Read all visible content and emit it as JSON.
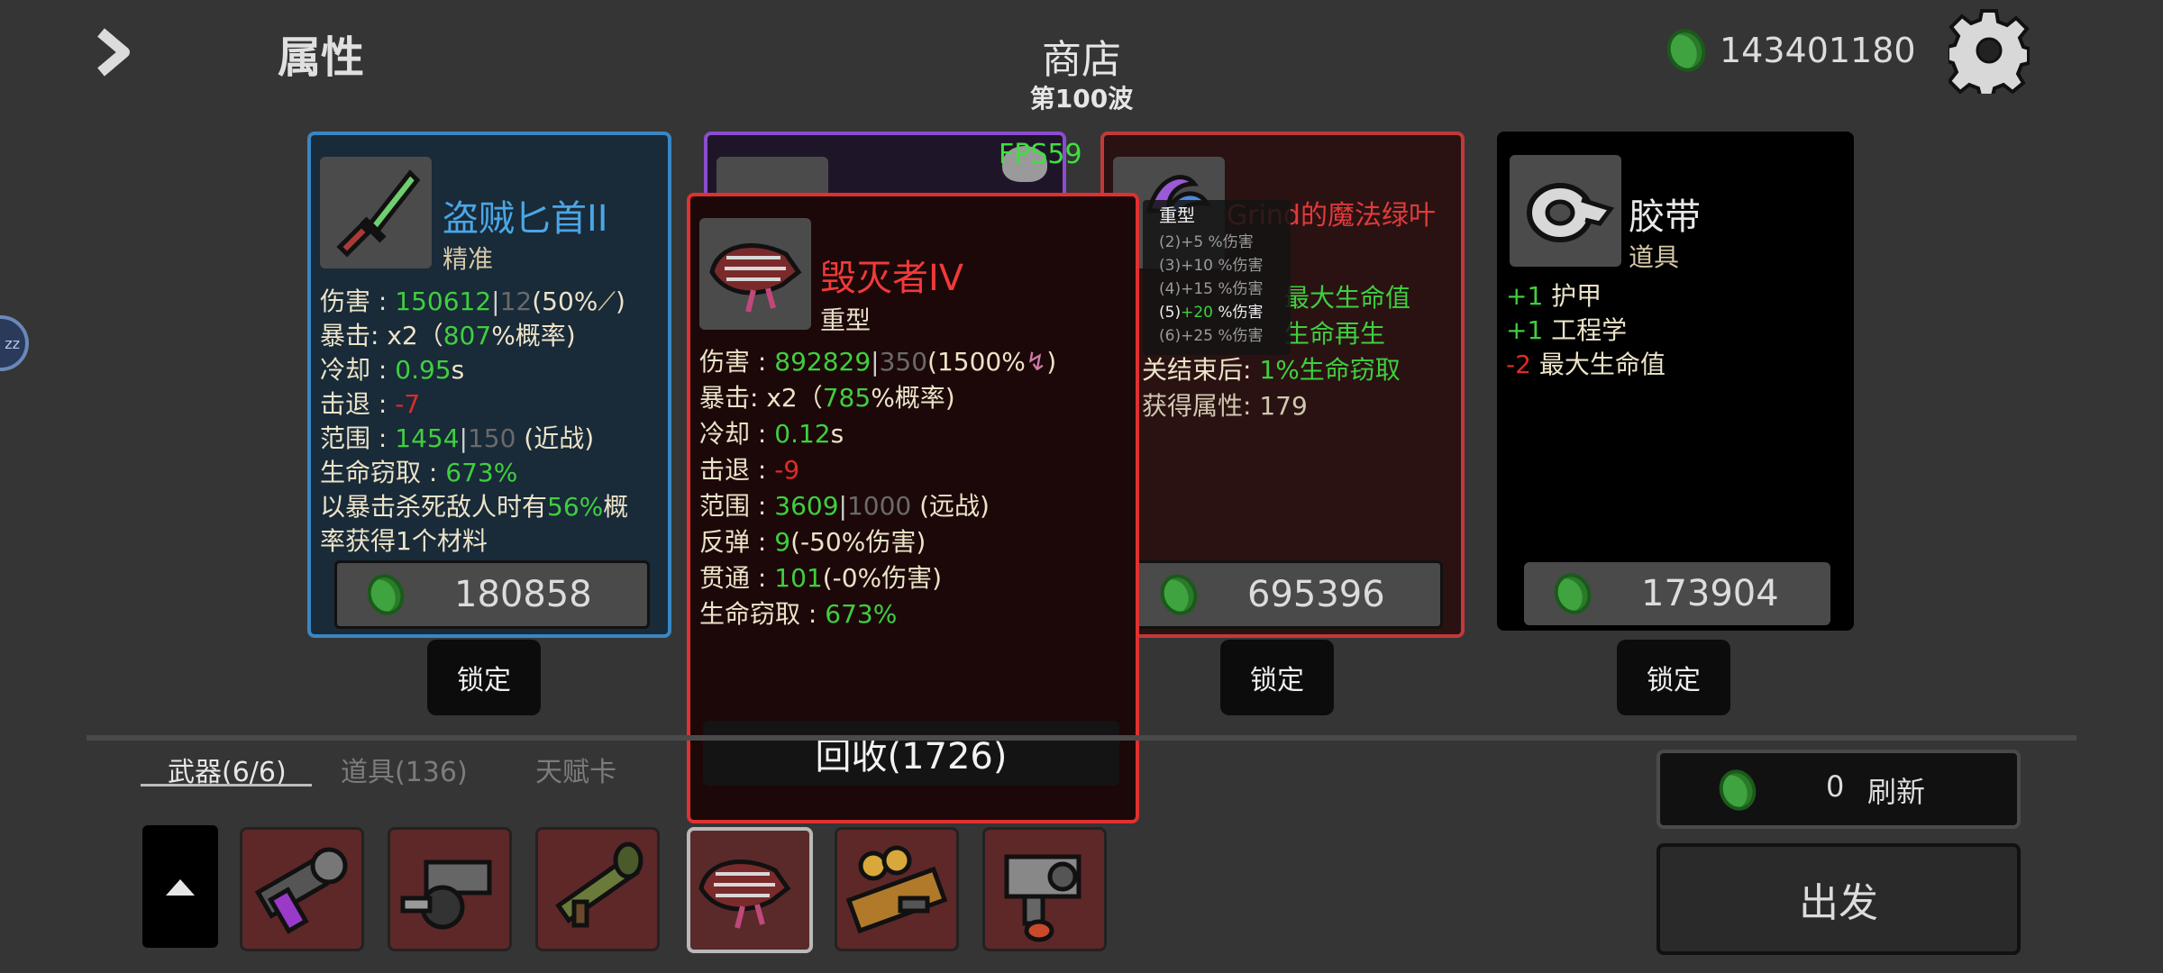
{
  "header": {
    "stats_label": "属性",
    "shop_title": "商店",
    "wave": "第100波",
    "money": "143401180"
  },
  "fps": "FPS59",
  "side_badge": "zz",
  "cards": [
    {
      "name": "盗贼匕首II",
      "type": "精准",
      "stats": {
        "dmg_label": "伤害 : ",
        "dmg_val": "150612",
        "dmg_base": "12",
        "dmg_scale": "(50%",
        "dmg_end": ")",
        "crit_label": "暴击:  x2（",
        "crit_val": "807",
        "crit_end": "%概率)",
        "cd_label": "冷却 : ",
        "cd_val": "0.95",
        "cd_unit": "s",
        "kb_label": "击退 : ",
        "kb_val": "-7",
        "range_label": "范围 : ",
        "range_val": "1454",
        "range_base": "150",
        "range_type": " (近战)",
        "ls_label": "生命窃取 : ",
        "ls_val": "673%",
        "effect_a": "以暴击杀死敌人时有",
        "effect_pct": "56%",
        "effect_b": "概",
        "effect_c": "率获得1个材料"
      },
      "price": "180858",
      "lock": "锁定"
    },
    {
      "name": "Grind的魔法绿叶",
      "price": "695396",
      "lock": "锁定",
      "line1": "最大生命值",
      "line2": "生命再生",
      "line3_a": "关结束后",
      "line3_b": "1",
      "line3_c": "%生命窃取",
      "line4": "获得属性:  179"
    },
    {
      "name": "胶带",
      "type": "道具",
      "effects": [
        {
          "val": "+1",
          "label": " 护甲",
          "color": "green"
        },
        {
          "val": "+1",
          "label": " 工程学",
          "color": "green"
        },
        {
          "val": "-2",
          "label": " 最大生命值",
          "color": "red"
        }
      ],
      "price": "173904",
      "lock": "锁定"
    }
  ],
  "popup": {
    "name": "毁灭者IV",
    "type": "重型",
    "dmg_label": "伤害 : ",
    "dmg_val": "892829",
    "dmg_base": "350",
    "dmg_scale": "(1500%",
    "dmg_end": ")",
    "crit_label": "暴击:  x2（",
    "crit_val": "785",
    "crit_end": "%概率)",
    "cd_label": "冷却 : ",
    "cd_val": "0.12",
    "cd_unit": "s",
    "kb_label": "击退 : ",
    "kb_val": "-9",
    "range_label": "范围 : ",
    "range_val": "3609",
    "range_base": "1000",
    "range_type": " (远战)",
    "bounce_label": "反弹 : ",
    "bounce_val": "9",
    "bounce_end": "(-50%伤害)",
    "pierce_label": "贯通 : ",
    "pierce_val": "101",
    "pierce_end": "(-0%伤害)",
    "ls_label": "生命窃取 : ",
    "ls_val": "673%",
    "recycle": "回收(1726)"
  },
  "tooltip": {
    "title": "重型",
    "lines": [
      "(2)+5 %伤害",
      "(3)+10 %伤害",
      "(4)+15 %伤害",
      "(6)+25 %伤害"
    ],
    "active_pre": "(5)",
    "active_val": "+20",
    "active_post": " %伤害"
  },
  "tabs": [
    "武器(6/6)",
    "道具(136)",
    "天赋卡"
  ],
  "refresh": {
    "count": "0",
    "label": "刷新"
  },
  "go": "出发",
  "colors": {
    "green": "#3fcf3f",
    "red": "#e02a2a",
    "blue_border": "#3a86c4",
    "purple_border": "#8b4ccd",
    "red_border": "#c03a3a"
  }
}
